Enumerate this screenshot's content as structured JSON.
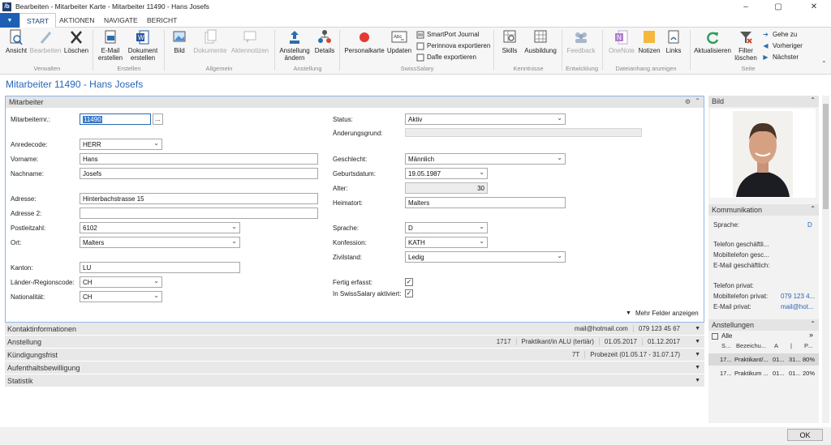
{
  "window": {
    "title": "Bearbeiten - Mitarbeiter Karte - Mitarbeiter 11490 - Hans Josefs",
    "minimize": "–",
    "maximize": "▢",
    "close": "✕"
  },
  "tabs": {
    "file_menu": "▼",
    "start": "START",
    "aktionen": "AKTIONEN",
    "navigate": "NAVIGATE",
    "bericht": "BERICHT"
  },
  "ribbon": {
    "ansicht": "Ansicht",
    "bearbeiten": "Bearbeiten",
    "loeschen": "Löschen",
    "email_line1": "E-Mail",
    "email_line2": "erstellen",
    "dokument_line1": "Dokument",
    "dokument_line2": "erstellen",
    "bild": "Bild",
    "dokumente": "Dokumente",
    "aktennotizen": "Aktennotizen",
    "anstellung_line1": "Anstellung",
    "anstellung_line2": "ändern",
    "details": "Details",
    "personalkarte": "Personalkarte",
    "updaten": "Updaten",
    "smartport": "SmartPort Journal",
    "perinnova": "Perinnova exportieren",
    "dafle": "Dafle exportieren",
    "skills": "Skills",
    "ausbildung": "Ausbildung",
    "feedback": "Feedback",
    "onenote": "OneNote",
    "notizen": "Notizen",
    "links": "Links",
    "aktualisieren": "Aktualisieren",
    "filter_line1": "Filter",
    "filter_line2": "löschen",
    "gehe_zu": "Gehe zu",
    "vorheriger": "Vorheriger",
    "naechster": "Nächster",
    "groups": {
      "verwalten": "Verwalten",
      "erstellen": "Erstellen",
      "allgemein": "Allgemein",
      "anstellung": "Anstellung",
      "swisssalary": "SwissSalary",
      "kenntnisse": "Kenntnisse",
      "entwicklung": "Entwicklung",
      "dateianhang": "Dateianhang anzeigen",
      "seite": "Seite"
    }
  },
  "page_title": "Mitarbeiter 11490 - Hans Josefs",
  "mitarbeiter": {
    "header": "Mitarbeiter",
    "labels": {
      "nr": "Mitarbeiternr.:",
      "anrede": "Anredecode:",
      "vorname": "Vorname:",
      "nachname": "Nachname:",
      "adresse": "Adresse:",
      "adresse2": "Adresse 2:",
      "plz": "Postleitzahl:",
      "ort": "Ort:",
      "kanton": "Kanton:",
      "land": "Länder-/Regionscode:",
      "nation": "Nationalität:",
      "status": "Status:",
      "grund": "Änderungsgrund:",
      "geschlecht": "Geschlecht:",
      "geburt": "Geburtsdatum:",
      "alter": "Alter:",
      "heimatort": "Heimatort:",
      "sprache": "Sprache:",
      "konfession": "Konfession:",
      "zivil": "Zivilstand:",
      "fertig": "Fertig erfasst:",
      "swiss": "In SwissSalary aktiviert:"
    },
    "values": {
      "nr": "11490",
      "anrede": "HERR",
      "vorname": "Hans",
      "nachname": "Josefs",
      "adresse": "Hinterbachstrasse 15",
      "adresse2": "",
      "plz": "6102",
      "ort": "Malters",
      "kanton": "LU",
      "land": "CH",
      "nation": "CH",
      "status": "Aktiv",
      "grund": "",
      "geschlecht": "Männlich",
      "geburt": "19.05.1987",
      "alter": "30",
      "heimatort": "Malters",
      "sprache": "D",
      "konfession": "KATH",
      "zivil": "Ledig",
      "fertig": "✓",
      "swiss": "✓"
    },
    "more_fields": "Mehr Felder anzeigen",
    "ellipsis": "...",
    "dropdown_glyph": "⌄"
  },
  "fastabs": [
    {
      "name": "Kontaktinformationen",
      "values": [
        "mail@hotmail.com",
        "079 123 45 67"
      ]
    },
    {
      "name": "Anstellung",
      "values": [
        "1717",
        "Praktikant/in ALU (tertiär)",
        "01.05.2017",
        "01.12.2017"
      ]
    },
    {
      "name": "Kündigungsfrist",
      "values": [
        "7T",
        "Probezeit (01.05.17 - 31.07.17)"
      ]
    },
    {
      "name": "Aufenthaltsbewilligung",
      "values": []
    },
    {
      "name": "Statistik",
      "values": []
    }
  ],
  "right": {
    "bild": "Bild",
    "kommunikation": "Kommunikation",
    "k_sprache": "Sprache:",
    "k_sprache_val": "D",
    "tel_gesch": "Telefon geschäftli...",
    "mobil_gesch": "Mobiltelefon gesc...",
    "mail_gesch": "E-Mail geschäftlich:",
    "tel_priv": "Telefon privat:",
    "mobil_priv": "Mobiltelefon privat:",
    "mobil_priv_val": "079 123 4...",
    "mail_priv": "E-Mail privat:",
    "mail_priv_val": "mail@hot...",
    "anstellungen": "Anstellungen",
    "alle": "Alle",
    "cols": [
      "S...",
      "Bezeichu...",
      "A",
      "|",
      "P..."
    ],
    "rows": [
      {
        "s": "17...",
        "b": "Praktikant/...",
        "a": "01...",
        "d": "31...",
        "p": "80%"
      },
      {
        "s": "17...",
        "b": "Praktikum ...",
        "a": "01...",
        "d": "01...",
        "p": "20%"
      }
    ],
    "expand": "»"
  },
  "ok": "OK"
}
